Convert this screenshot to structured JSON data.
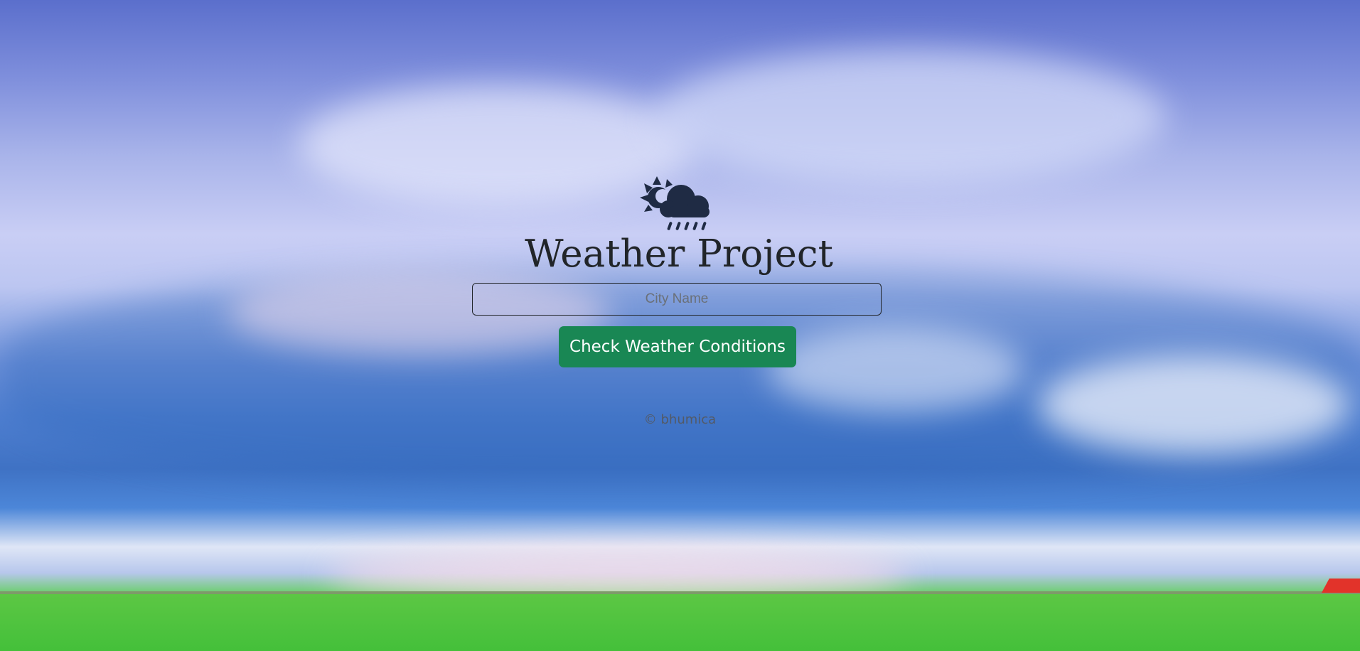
{
  "page": {
    "title": "Weather Project",
    "logo_icon": "sun-cloud-rain-icon"
  },
  "form": {
    "city_input_placeholder": "City Name",
    "city_input_value": "",
    "submit_label": "Check Weather Conditions"
  },
  "footer": {
    "text": "© bhumica"
  },
  "colors": {
    "button": "#198754",
    "title_text": "#212529",
    "icon": "#1f2b44"
  }
}
